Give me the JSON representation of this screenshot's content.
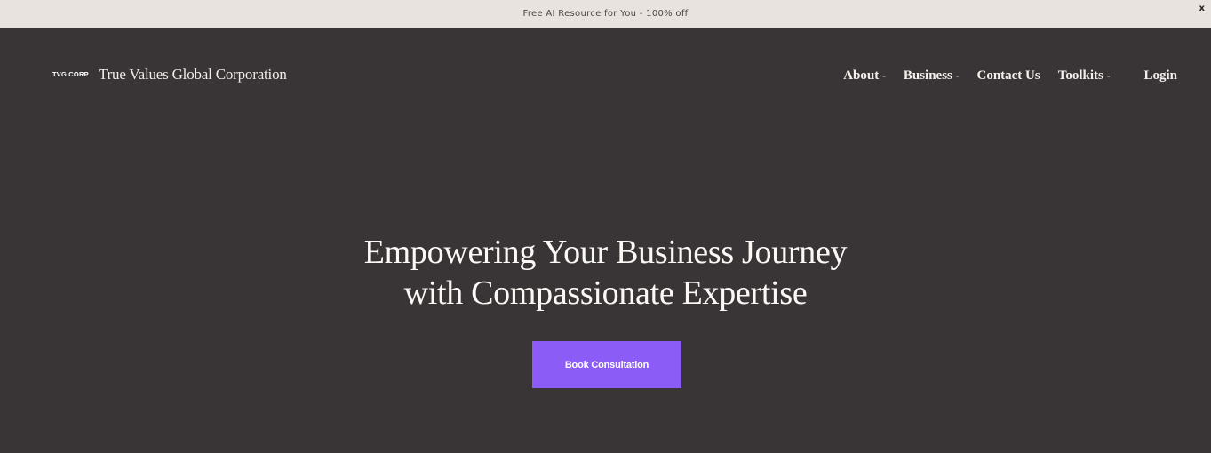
{
  "announcement": {
    "text": "Free AI Resource for You - 100% off",
    "close_label": "x"
  },
  "header": {
    "logo": {
      "mark_text": "TVG CORP",
      "name": "True Values Global Corporation",
      "accent_color": "#8b5cf6"
    },
    "nav": {
      "items": [
        {
          "label": "About",
          "has_dropdown": true,
          "caret": "-"
        },
        {
          "label": "Business",
          "has_dropdown": true,
          "caret": "-"
        },
        {
          "label": "Contact Us",
          "has_dropdown": false
        },
        {
          "label": "Toolkits",
          "has_dropdown": true,
          "caret": "-"
        }
      ],
      "login_label": "Login"
    }
  },
  "hero": {
    "title_line_1": "Empowering Your Business Journey",
    "title_line_2": "with Compassionate Expertise",
    "cta_label": "Book Consultation",
    "cta_color": "#8b5cf6"
  },
  "colors": {
    "page_background": "#393536",
    "announcement_background": "#e8e3de"
  }
}
